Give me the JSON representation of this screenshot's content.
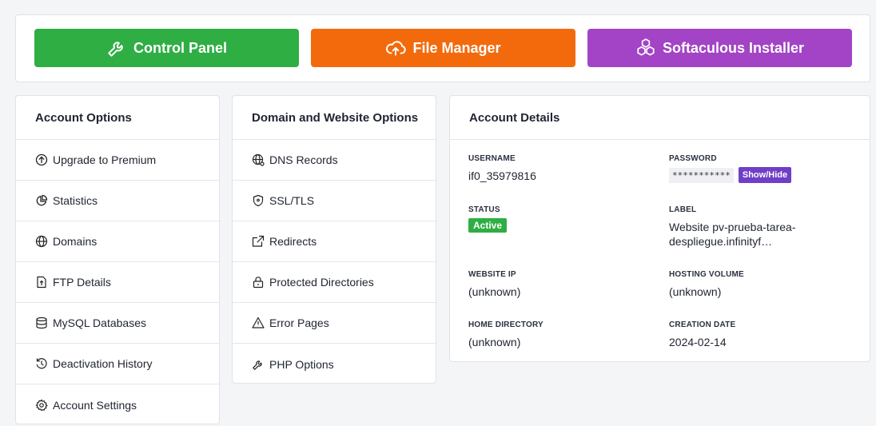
{
  "top_buttons": {
    "control_panel": "Control Panel",
    "file_manager": "File Manager",
    "softaculous": "Softaculous Installer"
  },
  "colors": {
    "green": "#2fae44",
    "orange": "#f36a0c",
    "purple": "#a343c5",
    "show_hide": "#6f3fc7"
  },
  "account_options": {
    "title": "Account Options",
    "items": [
      {
        "label": "Upgrade to Premium",
        "icon": "arrow-up-circle-icon"
      },
      {
        "label": "Statistics",
        "icon": "pie-chart-icon"
      },
      {
        "label": "Domains",
        "icon": "globe-icon"
      },
      {
        "label": "FTP Details",
        "icon": "file-upload-icon"
      },
      {
        "label": "MySQL Databases",
        "icon": "database-icon"
      },
      {
        "label": "Deactivation History",
        "icon": "history-icon"
      },
      {
        "label": "Account Settings",
        "icon": "gear-icon"
      }
    ]
  },
  "domain_options": {
    "title": "Domain and Website Options",
    "items": [
      {
        "label": "DNS Records",
        "icon": "globe-network-icon"
      },
      {
        "label": "SSL/TLS",
        "icon": "shield-icon"
      },
      {
        "label": "Redirects",
        "icon": "external-link-icon"
      },
      {
        "label": "Protected Directories",
        "icon": "lock-icon"
      },
      {
        "label": "Error Pages",
        "icon": "warning-icon"
      },
      {
        "label": "PHP Options",
        "icon": "wrench-icon"
      }
    ]
  },
  "account_details": {
    "title": "Account Details",
    "username_label": "USERNAME",
    "username": "if0_35979816",
    "password_label": "PASSWORD",
    "password_mask": "***********",
    "show_hide": "Show/Hide",
    "status_label": "STATUS",
    "status": "Active",
    "label_label": "LABEL",
    "label_line1": "Website pv-prueba-tarea-",
    "label_line2": "despliegue.infinityf…",
    "website_ip_label": "WEBSITE IP",
    "website_ip": "(unknown)",
    "hosting_volume_label": "HOSTING VOLUME",
    "hosting_volume": "(unknown)",
    "home_directory_label": "HOME DIRECTORY",
    "home_directory": "(unknown)",
    "creation_date_label": "CREATION DATE",
    "creation_date": "2024-02-14"
  }
}
